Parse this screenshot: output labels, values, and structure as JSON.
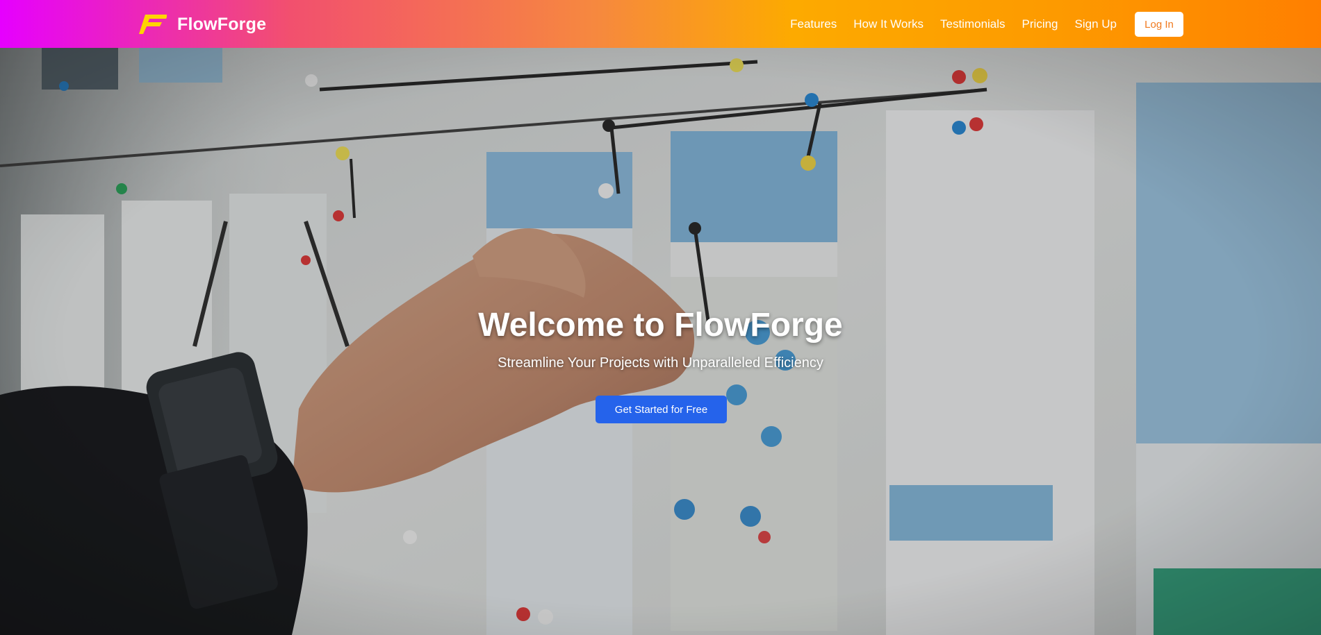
{
  "brand": {
    "name": "FlowForge",
    "icon": "bolt-f-logo-icon"
  },
  "nav": {
    "links": [
      "Features",
      "How It Works",
      "Testimonials",
      "Pricing",
      "Sign Up"
    ],
    "login_label": "Log In"
  },
  "hero": {
    "title": "Welcome to FlowForge",
    "subtitle": "Streamline Your Projects with Unparalleled Efficiency",
    "cta_label": "Get Started for Free",
    "background": "photo-hand-pinning-wireframes-on-board"
  },
  "colors": {
    "nav_gradient": [
      "#e600ff",
      "#f2506e",
      "#fdaa00",
      "#ff7f00"
    ],
    "logo_yellow": "#ffd400",
    "cta_blue": "#2563eb",
    "login_text": "#f07a1e"
  }
}
